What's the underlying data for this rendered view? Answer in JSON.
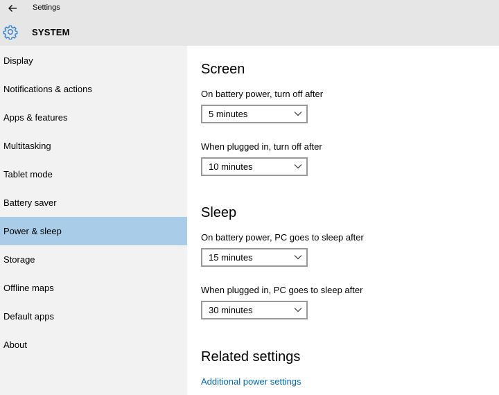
{
  "window": {
    "app_title": "Settings",
    "section_title": "SYSTEM"
  },
  "sidebar": {
    "items": [
      {
        "label": "Display"
      },
      {
        "label": "Notifications & actions"
      },
      {
        "label": "Apps & features"
      },
      {
        "label": "Multitasking"
      },
      {
        "label": "Tablet mode"
      },
      {
        "label": "Battery saver"
      },
      {
        "label": "Power & sleep",
        "selected": true
      },
      {
        "label": "Storage"
      },
      {
        "label": "Offline maps"
      },
      {
        "label": "Default apps"
      },
      {
        "label": "About"
      }
    ]
  },
  "main": {
    "screen": {
      "heading": "Screen",
      "battery_label": "On battery power, turn off after",
      "battery_value": "5 minutes",
      "plugged_label": "When plugged in, turn off after",
      "plugged_value": "10 minutes"
    },
    "sleep": {
      "heading": "Sleep",
      "battery_label": "On battery power, PC goes to sleep after",
      "battery_value": "15 minutes",
      "plugged_label": "When plugged in, PC goes to sleep after",
      "plugged_value": "30 minutes"
    },
    "related": {
      "heading": "Related settings",
      "link": "Additional power settings"
    }
  },
  "colors": {
    "header_bg": "#e6e6e6",
    "sidebar_bg": "#f2f2f2",
    "selected_bg": "#a9cde9",
    "accent": "#0067b8",
    "icon": "#2b7fd6"
  }
}
